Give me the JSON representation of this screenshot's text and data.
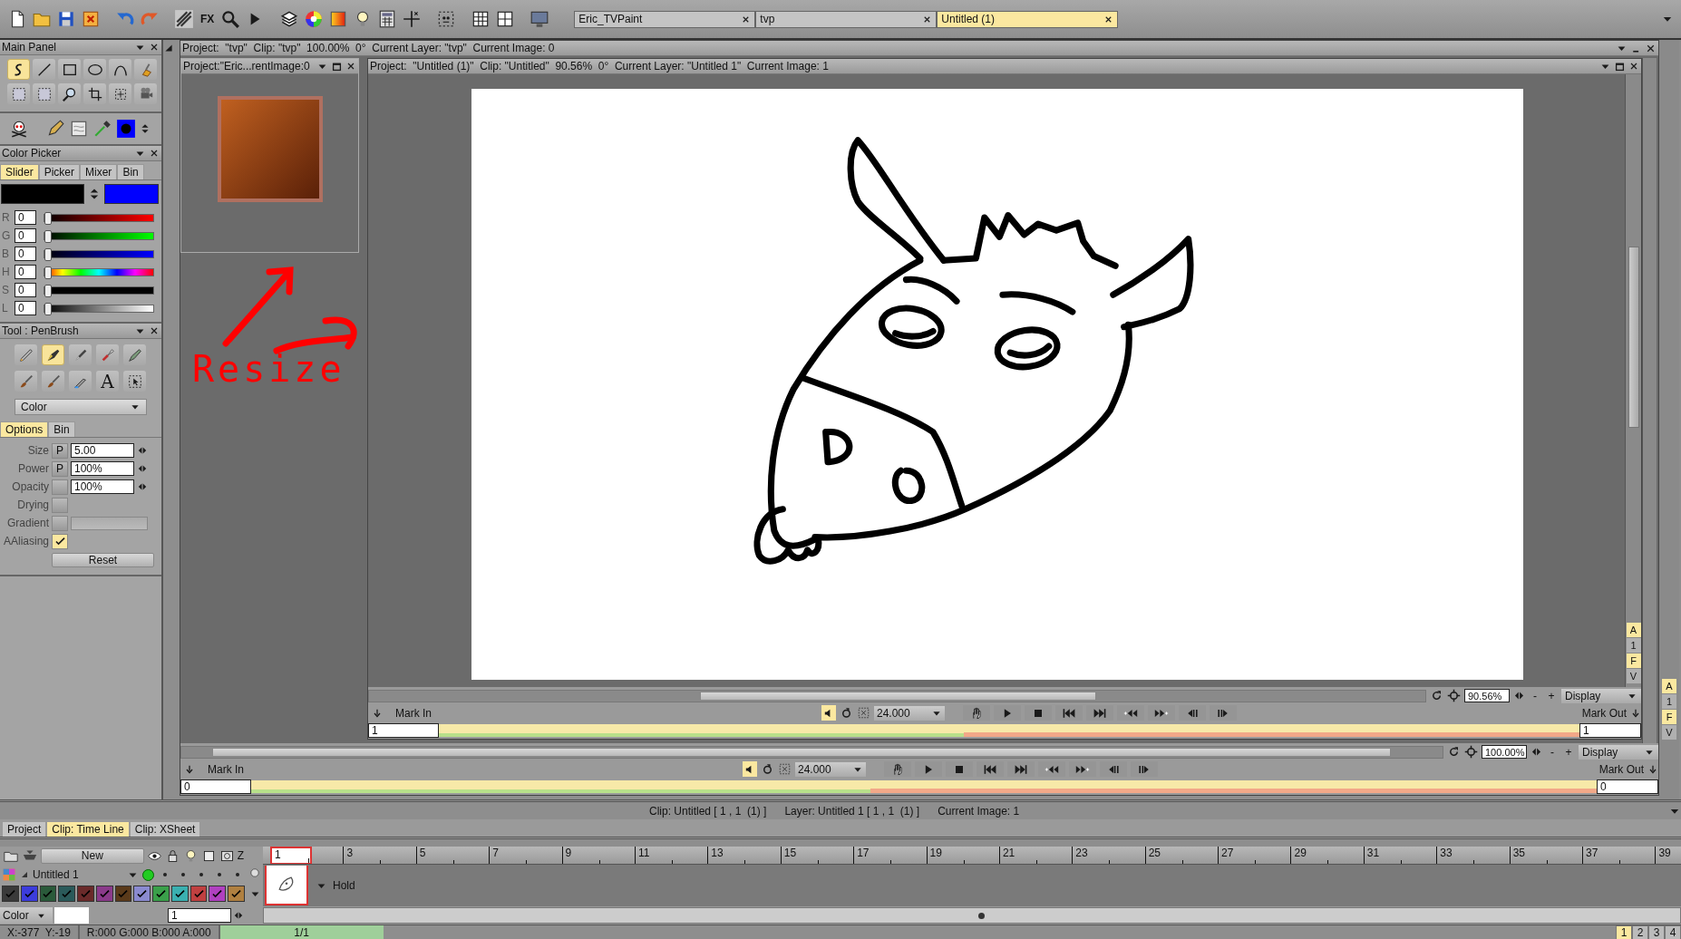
{
  "toolbar": {
    "fx": "FX",
    "documents": [
      {
        "label": "Eric_TVPaint",
        "selected": false
      },
      {
        "label": "tvp",
        "selected": false
      },
      {
        "label": "Untitled (1)",
        "selected": true
      }
    ]
  },
  "main_panel": {
    "title": "Main Panel",
    "tools": [
      {
        "selected": true
      },
      {
        "selected": false
      },
      {
        "selected": false
      },
      {
        "selected": false
      },
      {
        "selected": false
      },
      {
        "selected": false
      },
      {
        "selected": false
      },
      {
        "selected": false
      },
      {
        "selected": false
      },
      {
        "selected": false
      },
      {
        "selected": false
      },
      {
        "selected": false
      }
    ]
  },
  "color_picker": {
    "title": "Color Picker",
    "tabs": [
      {
        "label": "Slider",
        "selected": true
      },
      {
        "label": "Picker",
        "selected": false
      },
      {
        "label": "Mixer",
        "selected": false
      },
      {
        "label": "Bin",
        "selected": false
      }
    ],
    "swatches": [
      {
        "color": "#000000"
      },
      {
        "color": "#0000ff"
      }
    ],
    "channels": [
      {
        "name": "R",
        "value": "0",
        "level": 0
      },
      {
        "name": "G",
        "value": "0",
        "level": 0
      },
      {
        "name": "B",
        "value": "0",
        "level": 0
      },
      {
        "name": "H",
        "value": "0",
        "level": 0
      },
      {
        "name": "S",
        "value": "0",
        "level": 0
      },
      {
        "name": "L",
        "value": "0",
        "level": 0
      }
    ]
  },
  "tool_panel": {
    "title": "Tool : PenBrush",
    "tools": [
      {
        "selected": false
      },
      {
        "selected": true
      },
      {
        "selected": false
      },
      {
        "selected": false
      },
      {
        "selected": false
      },
      {
        "selected": false
      },
      {
        "selected": false
      },
      {
        "selected": false
      },
      {
        "label": "A",
        "selected": false
      },
      {
        "selected": false
      }
    ],
    "mode": "Color",
    "tabs": [
      {
        "label": "Options",
        "selected": true
      },
      {
        "label": "Bin",
        "selected": false
      }
    ],
    "options": [
      {
        "label": "Size",
        "kind": "pressure",
        "button": "P",
        "value": "5.00"
      },
      {
        "label": "Power",
        "kind": "pressure",
        "button": "P",
        "value": "100%"
      },
      {
        "label": "Opacity",
        "kind": "field",
        "value": "100%",
        "checked": false
      },
      {
        "label": "Drying",
        "kind": "toggle",
        "checked": false
      },
      {
        "label": "Gradient",
        "kind": "gradient",
        "checked": false
      },
      {
        "label": "AAliasing",
        "kind": "toggle",
        "checked": true
      }
    ],
    "reset": "Reset"
  },
  "outer_window": {
    "title": "Project:  \"tvp\"  Clip: \"tvp\"  100.00%  0°  Current Layer: \"tvp\"  Current Image: 0",
    "controls": {
      "zoom": "100.00%",
      "zoom_out": "-",
      "zoom_in": "+",
      "display": "Display",
      "mark_in": "Mark In",
      "fps": "24.000",
      "mark_out": "Mark Out",
      "start": "0",
      "end": "0",
      "sound_on": true
    },
    "side_letters": [
      {
        "label": "A",
        "on": true
      },
      {
        "label": "1",
        "on": false
      },
      {
        "label": "F",
        "on": true
      },
      {
        "label": "V",
        "on": false
      }
    ]
  },
  "thumbnail_window": {
    "title": "Project:\"Eric...rentImage:0"
  },
  "annotation": {
    "text": "Resize"
  },
  "inner_window": {
    "title": "Project:  \"Untitled (1)\"  Clip: \"Untitled\"  90.56%  0°  Current Layer: \"Untitled 1\"  Current Image: 1",
    "controls": {
      "zoom": "90.56%",
      "zoom_out": "-",
      "zoom_in": "+",
      "display": "Display",
      "mark_in": "Mark In",
      "fps": "24.000",
      "mark_out": "Mark Out",
      "start": "1",
      "end": "1",
      "sound_on": true
    },
    "side_letters": [
      {
        "label": "A",
        "on": true
      },
      {
        "label": "1",
        "on": false
      },
      {
        "label": "F",
        "on": true
      },
      {
        "label": "V",
        "on": false
      }
    ]
  },
  "info_bar": {
    "clip": "Clip: Untitled [ 1 , 1  (1) ]",
    "layer": "Layer: Untitled 1 [ 1 , 1  (1) ]",
    "image": "Current Image: 1"
  },
  "bottom_tabs": [
    {
      "label": "Project",
      "selected": false
    },
    {
      "label": "Clip: Time Line",
      "selected": true
    },
    {
      "label": "Clip: XSheet",
      "selected": false
    }
  ],
  "timeline": {
    "new": "New",
    "z": "Z",
    "ruler": [
      "1",
      "3",
      "5",
      "7",
      "9",
      "11",
      "13",
      "15",
      "17",
      "19",
      "21",
      "23",
      "25",
      "27",
      "29",
      "31",
      "33",
      "35",
      "37",
      "39"
    ],
    "layer": {
      "name": "Untitled 1",
      "hold": "Hold"
    },
    "swatches": [
      {
        "color": "#3a3a3a",
        "checked": true
      },
      {
        "color": "#3c3cdc",
        "checked": true
      },
      {
        "color": "#2a5a3a",
        "checked": true
      },
      {
        "color": "#2a5a5a",
        "checked": true
      },
      {
        "color": "#6a2a2a",
        "checked": true
      },
      {
        "color": "#8a3a8a",
        "checked": true
      },
      {
        "color": "#5a3a1a",
        "checked": true
      },
      {
        "color": "#8a8ad0",
        "checked": true
      },
      {
        "color": "#3aa04a",
        "checked": true
      },
      {
        "color": "#3ab0b0",
        "checked": true
      },
      {
        "color": "#c04040",
        "checked": true
      },
      {
        "color": "#b040c0",
        "checked": true
      },
      {
        "color": "#b08040",
        "checked": true
      }
    ],
    "color_mode": "Color",
    "frame": "1"
  },
  "status_bar": {
    "coords": "X:-377  Y:-19",
    "rgba": "R:000 G:000 B:000 A:000",
    "progress": "1/1",
    "level": 1,
    "pages": [
      {
        "label": "1",
        "selected": true
      },
      {
        "label": "2",
        "selected": false
      },
      {
        "label": "3",
        "selected": false
      },
      {
        "label": "4",
        "selected": false
      }
    ]
  }
}
